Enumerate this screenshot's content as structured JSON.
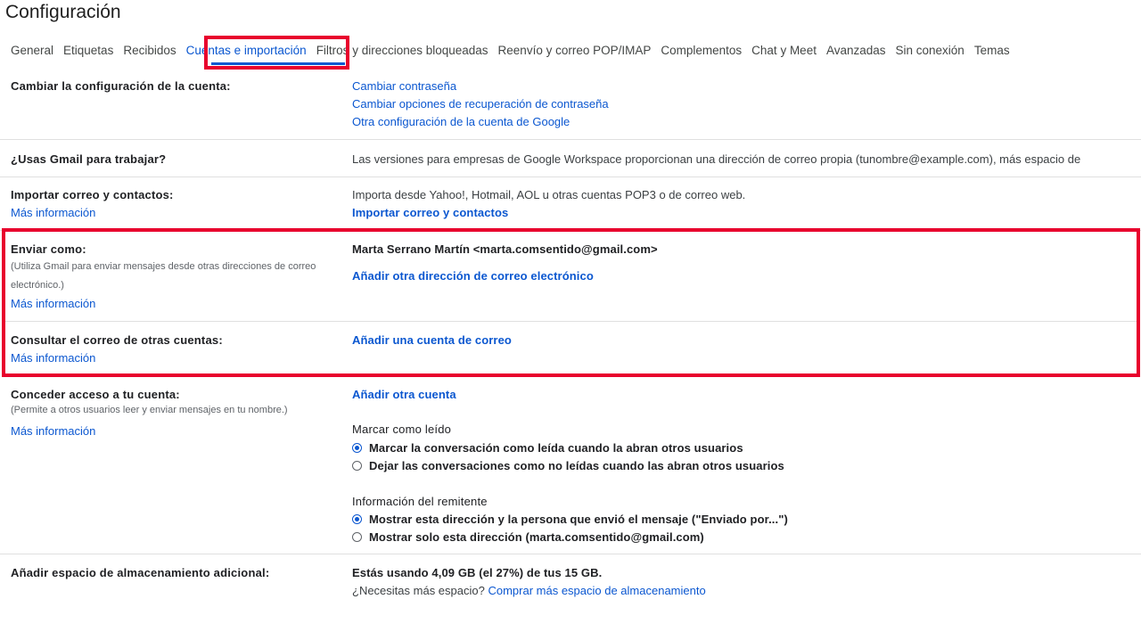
{
  "page": {
    "title": "Configuración"
  },
  "tabs": [
    {
      "label": "General"
    },
    {
      "label": "Etiquetas"
    },
    {
      "label": "Recibidos"
    },
    {
      "label": "Cuentas e importación",
      "active": true
    },
    {
      "label": "Filtros y direcciones bloqueadas"
    },
    {
      "label": "Reenvío y correo POP/IMAP"
    },
    {
      "label": "Complementos"
    },
    {
      "label": "Chat y Meet"
    },
    {
      "label": "Avanzadas"
    },
    {
      "label": "Sin conexión"
    },
    {
      "label": "Temas"
    }
  ],
  "sections": {
    "account": {
      "label": "Cambiar la configuración de la cuenta:",
      "links": [
        "Cambiar contraseña",
        "Cambiar opciones de recuperación de contraseña",
        "Otra configuración de la cuenta de Google"
      ]
    },
    "work": {
      "label": "¿Usas Gmail para trabajar?",
      "text": "Las versiones para empresas de Google Workspace proporcionan una dirección de correo propia (tunombre@example.com), más espacio de"
    },
    "import": {
      "label": "Importar correo y contactos:",
      "more": "Más información",
      "text": "Importa desde Yahoo!, Hotmail, AOL u otras cuentas POP3 o de correo web.",
      "action": "Importar correo y contactos"
    },
    "send_as": {
      "label": "Enviar como:",
      "sub": "(Utiliza Gmail para enviar mensajes desde otras direcciones de correo electrónico.)",
      "more": "Más información",
      "identity": "Marta Serrano Martín <marta.comsentido@gmail.com>",
      "action": "Añadir otra dirección de correo electrónico"
    },
    "check_mail": {
      "label": "Consultar el correo de otras cuentas:",
      "more": "Más información",
      "action": "Añadir una cuenta de correo"
    },
    "grant": {
      "label": "Conceder acceso a tu cuenta:",
      "sub": "(Permite a otros usuarios leer y enviar mensajes en tu nombre.)",
      "more": "Más información",
      "action": "Añadir otra cuenta",
      "mark_read": {
        "heading": "Marcar como leído",
        "options": [
          "Marcar la conversación como leída cuando la abran otros usuarios",
          "Dejar las conversaciones como no leídas cuando las abran otros usuarios"
        ],
        "selected": 0
      },
      "sender_info": {
        "heading": "Información del remitente",
        "options": [
          "Mostrar esta dirección y la persona que envió el mensaje (\"Enviado por...\")",
          "Mostrar solo esta dirección (marta.comsentido@gmail.com)"
        ],
        "selected": 0
      }
    },
    "storage": {
      "label": "Añadir espacio de almacenamiento adicional:",
      "usage": "Estás usando 4,09 GB (el 27%) de tus 15 GB.",
      "question": "¿Necesitas más espacio?",
      "buy_link": "Comprar más espacio de almacenamiento"
    }
  },
  "colors": {
    "accent": "#0b57d0",
    "highlight": "#e8002d"
  }
}
